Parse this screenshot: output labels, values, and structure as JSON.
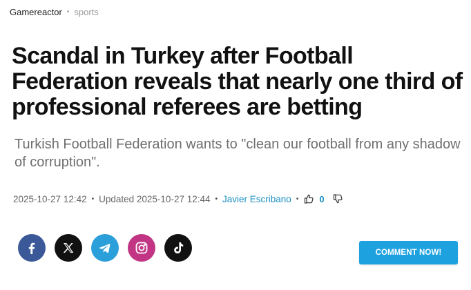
{
  "breadcrumb": {
    "site": "Gamereactor",
    "section": "sports"
  },
  "article": {
    "headline": "Scandal in Turkey after Football Federation reveals that nearly one third of professional referees are betting",
    "subheadline": "Turkish Football Federation wants to \"clean our football from any shadow of corruption\"."
  },
  "meta": {
    "published": "2025-10-27 12:42",
    "updated": "Updated 2025-10-27 12:44",
    "author": "Javier Escribano",
    "likes": "0"
  },
  "social": {
    "icons": [
      "facebook-icon",
      "x-icon",
      "telegram-icon",
      "instagram-icon",
      "tiktok-icon"
    ]
  },
  "actions": {
    "comment_label": "COMMENT NOW!"
  },
  "colors": {
    "accent": "#1ea2df",
    "author_link": "#1a8fc4",
    "facebook": "#3b5998",
    "telegram": "#2a9fd9",
    "instagram": "#c13584"
  }
}
